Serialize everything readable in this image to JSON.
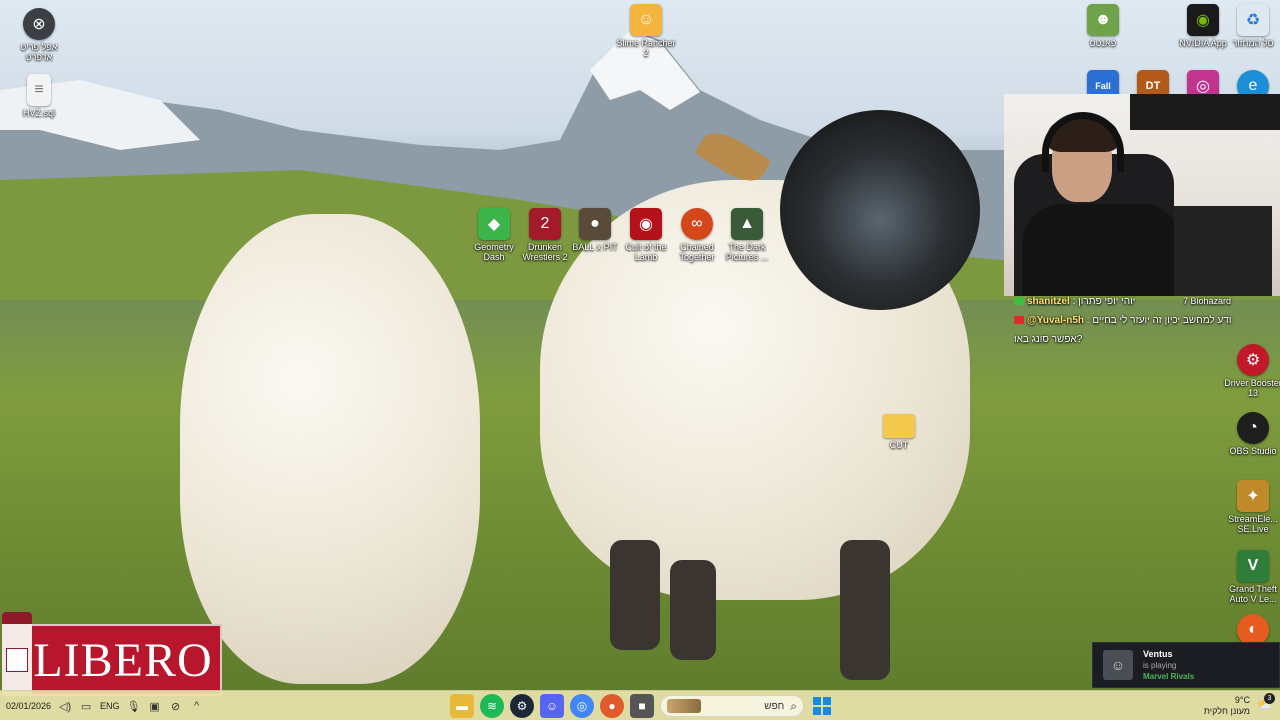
{
  "desktop_icons": [
    {
      "label": "אפל פריט אדפרט",
      "icon": "app-circle-icon",
      "color": "#3c3f44"
    },
    {
      "label": "HVZ.sql",
      "icon": "file-icon",
      "color": "#eeeeee"
    },
    {
      "label": "Slime Rancher 2",
      "icon": "slime-rancher-icon",
      "color": "#f4b43d"
    },
    {
      "label": "Geometry Dash",
      "icon": "geometry-dash-icon",
      "color": "#3bb54a"
    },
    {
      "label": "Drunken Wrestlers 2",
      "icon": "drunken-wrestlers-icon",
      "color": "#a31b2b"
    },
    {
      "label": "BALL x PIT",
      "icon": "ball-x-pit-icon",
      "color": "#5a4a3a"
    },
    {
      "label": "Cult of the Lamb",
      "icon": "cult-of-the-lamb-icon",
      "color": "#b3121b"
    },
    {
      "label": "Chained Together",
      "icon": "chained-together-icon",
      "color": "#d4471b"
    },
    {
      "label": "The Dark Pictures ...",
      "icon": "dark-pictures-icon",
      "color": "#3a5a3a"
    },
    {
      "label": "CUT",
      "icon": "folder-icon",
      "color": "#f2c94c"
    },
    {
      "label": "פאנטס",
      "icon": "game-character-icon",
      "color": "#6fa34a"
    },
    {
      "label": "NVIDIA App",
      "icon": "nvidia-icon",
      "color": "#1a1a1a"
    },
    {
      "label": "סל המחזור",
      "icon": "recycle-bin-icon",
      "color": "#dfe8f0"
    },
    {
      "label": "Fall",
      "icon": "fall-guys-icon",
      "color": "#2b6fd6"
    },
    {
      "label": "DT",
      "icon": "dt-app-icon",
      "color": "#b35a1a"
    },
    {
      "label": "",
      "icon": "instagram-icon",
      "color": "#c1358f"
    },
    {
      "label": "",
      "icon": "edge-icon",
      "color": "#1d8fd6"
    },
    {
      "label": "7 Biohazard",
      "icon": "biohazard-icon",
      "color": "#444"
    },
    {
      "label": "Driver Booster 13",
      "icon": "driver-booster-icon",
      "color": "#c2192a"
    },
    {
      "label": "OBS Studio",
      "icon": "obs-icon",
      "color": "#1e1e1e"
    },
    {
      "label": "StreamEle... SE.Live",
      "icon": "streamelements-icon",
      "color": "#c08a2a"
    },
    {
      "label": "Grand Theft Auto V Le...",
      "icon": "gta-v-icon",
      "color": "#2f7d3a"
    },
    {
      "label": "",
      "icon": "orange-app-icon",
      "color": "#e65b1f"
    }
  ],
  "chat": [
    {
      "user": "shanitzel",
      "message": "יוהי יופי פתרון",
      "badge_color": "#3fbf3f"
    },
    {
      "user": "@Yuval-n5h",
      "message": "ודע למחשב יכיון זה יועזר לי בחיים",
      "badge_color": "#e02828"
    },
    {
      "user": "",
      "message": "אפשר סונג באו?",
      "badge_color": ""
    }
  ],
  "libero": {
    "brand": "LIBERO"
  },
  "notification": {
    "title": "Ventus",
    "status": "is playing",
    "game": "Marvel Rivals"
  },
  "taskbar": {
    "date": "02/01/2026",
    "language": "ENG",
    "search_placeholder": "חפש",
    "weather_temp": "9°C",
    "weather_desc": "מעונן חלקית",
    "notification_count": "3",
    "apps": [
      {
        "name": "file-explorer-icon",
        "color": "#e8b93a"
      },
      {
        "name": "spotify-icon",
        "color": "#1db954"
      },
      {
        "name": "steam-icon",
        "color": "#1b2838"
      },
      {
        "name": "discord-icon",
        "color": "#5865f2"
      },
      {
        "name": "chrome-icon",
        "color": "#4285f4"
      },
      {
        "name": "paint-icon",
        "color": "#e05a2a"
      },
      {
        "name": "app-window-icon",
        "color": "#555555"
      }
    ]
  }
}
